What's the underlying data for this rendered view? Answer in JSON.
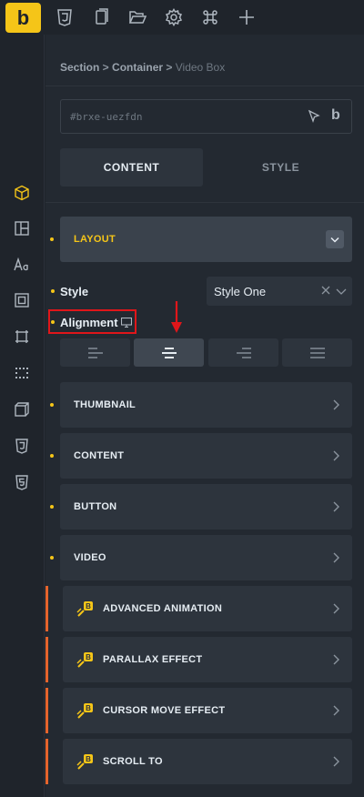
{
  "toolbar": {
    "logo": "b",
    "icons": [
      "css3-icon",
      "pages-icon",
      "folder-open-icon",
      "gear-icon",
      "command-icon",
      "plus-icon"
    ]
  },
  "sidebar": {
    "icons": [
      "cube-icon",
      "layout-icon",
      "typography-icon",
      "spacing-icon",
      "border-box-icon",
      "grid-dots-icon",
      "transform-icon",
      "css3-icon",
      "html5-icon"
    ],
    "accent": "#f5c518"
  },
  "breadcrumb": {
    "part1": "Section",
    "sep1": " > ",
    "part2": "Container",
    "sep2": " > ",
    "current": "Video Box"
  },
  "element_id": {
    "value": "#brxe-uezfdn",
    "suffix": "b"
  },
  "tabs": {
    "content": "CONTENT",
    "style": "STYLE"
  },
  "layout": {
    "label": "LAYOUT",
    "style_label": "Style",
    "style_value": "Style One",
    "alignment_label": "Alignment",
    "alignment_options": [
      "left",
      "center",
      "right",
      "justify"
    ],
    "alignment_selected": "center"
  },
  "groups": [
    "THUMBNAIL",
    "CONTENT",
    "BUTTON",
    "VIDEO"
  ],
  "plugin_groups": [
    "ADVANCED ANIMATION",
    "PARALLAX EFFECT",
    "CURSOR MOVE EFFECT",
    "SCROLL TO"
  ],
  "colors": {
    "accent": "#f5c518",
    "highlight": "#e0161a",
    "plugin": "#e5642c"
  }
}
